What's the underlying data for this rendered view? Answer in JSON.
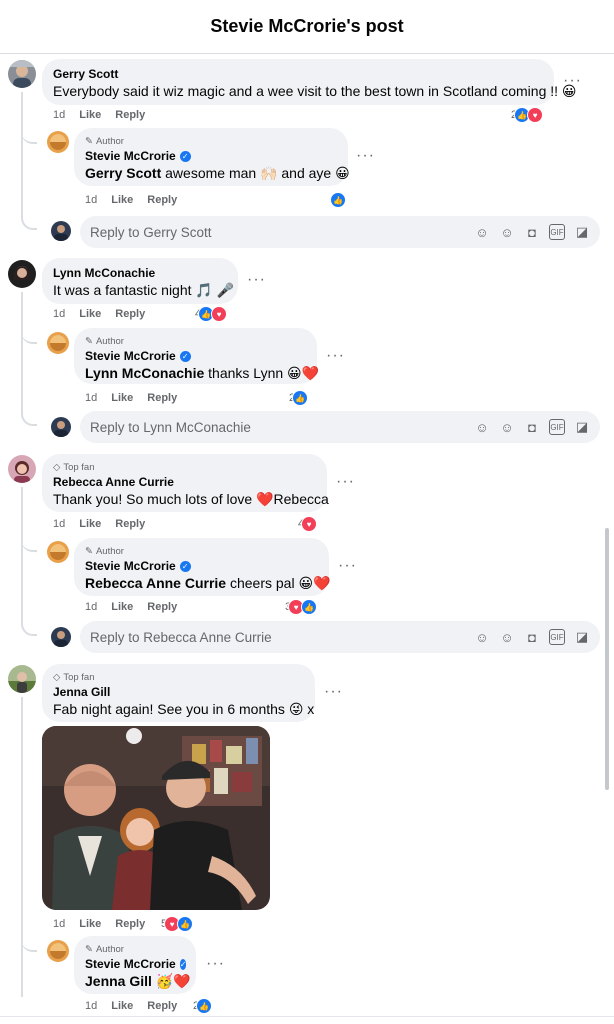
{
  "header": {
    "title": "Stevie McCrorie's post"
  },
  "comments": [
    {
      "name": "Gerry Scott",
      "text": "Everybody said it wiz magic and a wee visit to the best town in Scotland coming !! ",
      "emoji": "😀",
      "time": "1d",
      "like": "Like",
      "reply": "Reply",
      "reaction_count": "2",
      "reply_item": {
        "tag": "Author",
        "name": "Stevie McCrorie",
        "mention": "Gerry Scott",
        "text": " awesome man 🙌🏻 and aye 😀",
        "time": "1d",
        "like": "Like",
        "reply": "Reply",
        "reaction_count": ""
      },
      "reply_placeholder": "Reply to Gerry Scott"
    },
    {
      "name": "Lynn McConachie",
      "text": "It was a fantastic night 🎵 🎤",
      "time": "1d",
      "like": "Like",
      "reply": "Reply",
      "reaction_count": "4",
      "reply_item": {
        "tag": "Author",
        "name": "Stevie McCrorie",
        "mention": "Lynn McConachie",
        "text": " thanks Lynn 😀❤️",
        "time": "1d",
        "like": "Like",
        "reply": "Reply",
        "reaction_count": "2"
      },
      "reply_placeholder": "Reply to Lynn McConachie"
    },
    {
      "tag": "Top fan",
      "name": "Rebecca Anne Currie",
      "text": "Thank you! So much lots of love ❤️Rebecca",
      "time": "1d",
      "like": "Like",
      "reply": "Reply",
      "reaction_count": "4",
      "reply_item": {
        "tag": "Author",
        "name": "Stevie McCrorie",
        "mention": "Rebecca Anne Currie",
        "text": " cheers pal 😀❤️",
        "time": "1d",
        "like": "Like",
        "reply": "Reply",
        "reaction_count": "3"
      },
      "reply_placeholder": "Reply to Rebecca Anne Currie"
    },
    {
      "tag": "Top fan",
      "name": "Jenna Gill",
      "text": "Fab night again! See you in 6 months 😜 x",
      "time": "1d",
      "like": "Like",
      "reply": "Reply",
      "reaction_count": "5",
      "reply_item": {
        "tag": "Author",
        "name": "Stevie McCrorie",
        "mention": "Jenna Gill",
        "text": " 🥳❤️",
        "time": "1d",
        "like": "Like",
        "reply": "Reply",
        "reaction_count": "2"
      }
    }
  ],
  "icons": [
    "sticker-icon",
    "emoji-icon",
    "camera-icon",
    "gif-icon",
    "avatar-sticker-icon",
    "pencil-icon",
    "diamond-icon",
    "verified-icon",
    "like-icon",
    "love-icon"
  ],
  "colors": {
    "like": "#1877f2",
    "love": "#f33e58",
    "bubble": "#f0f2f5",
    "meta": "#65676b"
  }
}
